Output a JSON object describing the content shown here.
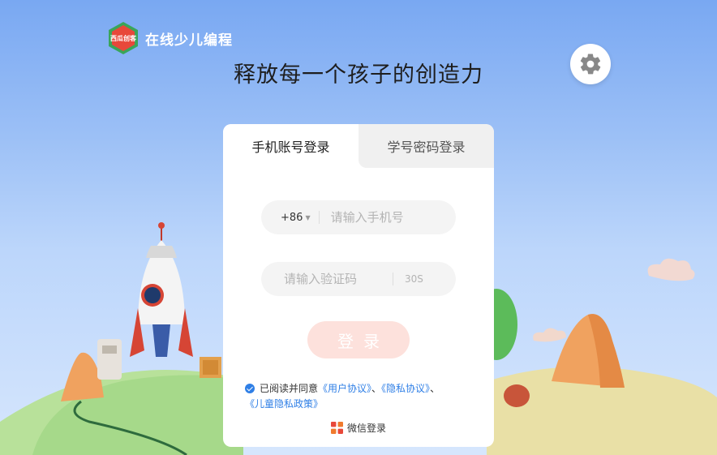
{
  "brand": {
    "logo_text": "西瓜创客",
    "name": "在线少儿编程"
  },
  "slogan": "释放每一个孩子的创造力",
  "tabs": [
    {
      "label": "手机账号登录",
      "active": true
    },
    {
      "label": "学号密码登录",
      "active": false
    }
  ],
  "phone": {
    "prefix": "+86",
    "placeholder": "请输入手机号",
    "value": ""
  },
  "code": {
    "placeholder": "请输入验证码",
    "value": "",
    "countdown": "30S"
  },
  "login_button": "登录",
  "agreement": {
    "checked": true,
    "prefix": "已阅读并同意",
    "user_agreement": "《用户协议》",
    "sep1": "、",
    "privacy_policy": "《隐私协议》",
    "sep2": "、",
    "child_privacy_policy": "《儿童隐私政策》"
  },
  "wechat_login": "微信登录",
  "colors": {
    "accent": "#2f7fe6",
    "login_button_bg": "#fde1dc",
    "brand_red": "#e8483a",
    "brand_green": "#3aa55a"
  }
}
